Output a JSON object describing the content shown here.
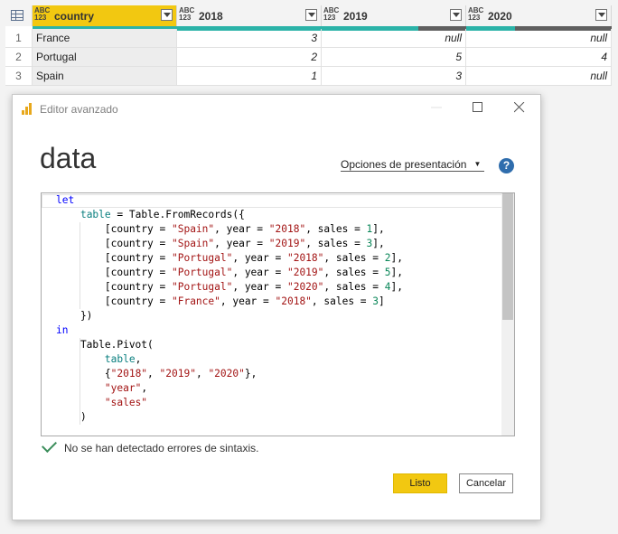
{
  "grid": {
    "columns": [
      {
        "name": "country",
        "type": "ABC\n123",
        "selected": true
      },
      {
        "name": "2018",
        "type": "ABC\n123",
        "selected": false
      },
      {
        "name": "2019",
        "type": "ABC\n123",
        "selected": false
      },
      {
        "name": "2020",
        "type": "ABC\n123",
        "selected": false
      }
    ],
    "rows": [
      {
        "index": "1",
        "country": "France",
        "v2018": "3",
        "v2019": "null",
        "v2020": "null"
      },
      {
        "index": "2",
        "country": "Portugal",
        "v2018": "2",
        "v2019": "5",
        "v2020": "4"
      },
      {
        "index": "3",
        "country": "Spain",
        "v2018": "1",
        "v2019": "3",
        "v2020": "null"
      }
    ],
    "quality_colors": {
      "valid": "#2bb3a8",
      "empty": "#5f5f5f"
    }
  },
  "dialog": {
    "title": "Editor avanzado",
    "query_name": "data",
    "presentation_options": "Opciones de presentación",
    "help": "?",
    "code_lines": [
      [
        [
          "kw",
          "let"
        ]
      ],
      [
        [
          "pl",
          "    "
        ],
        [
          "vr",
          "table"
        ],
        [
          "pl",
          " = Table.FromRecords({"
        ]
      ],
      [
        [
          "pl",
          "        [country = "
        ],
        [
          "st",
          "\"Spain\""
        ],
        [
          "pl",
          ", year = "
        ],
        [
          "st",
          "\"2018\""
        ],
        [
          "pl",
          ", sales = "
        ],
        [
          "nm",
          "1"
        ],
        [
          "pl",
          "],"
        ]
      ],
      [
        [
          "pl",
          "        [country = "
        ],
        [
          "st",
          "\"Spain\""
        ],
        [
          "pl",
          ", year = "
        ],
        [
          "st",
          "\"2019\""
        ],
        [
          "pl",
          ", sales = "
        ],
        [
          "nm",
          "3"
        ],
        [
          "pl",
          "],"
        ]
      ],
      [
        [
          "pl",
          "        [country = "
        ],
        [
          "st",
          "\"Portugal\""
        ],
        [
          "pl",
          ", year = "
        ],
        [
          "st",
          "\"2018\""
        ],
        [
          "pl",
          ", sales = "
        ],
        [
          "nm",
          "2"
        ],
        [
          "pl",
          "],"
        ]
      ],
      [
        [
          "pl",
          "        [country = "
        ],
        [
          "st",
          "\"Portugal\""
        ],
        [
          "pl",
          ", year = "
        ],
        [
          "st",
          "\"2019\""
        ],
        [
          "pl",
          ", sales = "
        ],
        [
          "nm",
          "5"
        ],
        [
          "pl",
          "],"
        ]
      ],
      [
        [
          "pl",
          "        [country = "
        ],
        [
          "st",
          "\"Portugal\""
        ],
        [
          "pl",
          ", year = "
        ],
        [
          "st",
          "\"2020\""
        ],
        [
          "pl",
          ", sales = "
        ],
        [
          "nm",
          "4"
        ],
        [
          "pl",
          "],"
        ]
      ],
      [
        [
          "pl",
          "        [country = "
        ],
        [
          "st",
          "\"France\""
        ],
        [
          "pl",
          ", year = "
        ],
        [
          "st",
          "\"2018\""
        ],
        [
          "pl",
          ", sales = "
        ],
        [
          "nm",
          "3"
        ],
        [
          "pl",
          "]"
        ]
      ],
      [
        [
          "pl",
          "    })"
        ]
      ],
      [
        [
          "kw",
          "in"
        ]
      ],
      [
        [
          "pl",
          "    Table.Pivot("
        ]
      ],
      [
        [
          "pl",
          "        "
        ],
        [
          "vr",
          "table"
        ],
        [
          "pl",
          ","
        ]
      ],
      [
        [
          "pl",
          "        {"
        ],
        [
          "st",
          "\"2018\""
        ],
        [
          "pl",
          ", "
        ],
        [
          "st",
          "\"2019\""
        ],
        [
          "pl",
          ", "
        ],
        [
          "st",
          "\"2020\""
        ],
        [
          "pl",
          "},"
        ]
      ],
      [
        [
          "pl",
          "        "
        ],
        [
          "st",
          "\"year\""
        ],
        [
          "pl",
          ","
        ]
      ],
      [
        [
          "pl",
          "        "
        ],
        [
          "st",
          "\"sales\""
        ]
      ],
      [
        [
          "pl",
          "    )"
        ]
      ]
    ],
    "status": "No se han detectado errores de sintaxis.",
    "ok_label": "Listo",
    "cancel_label": "Cancelar"
  }
}
